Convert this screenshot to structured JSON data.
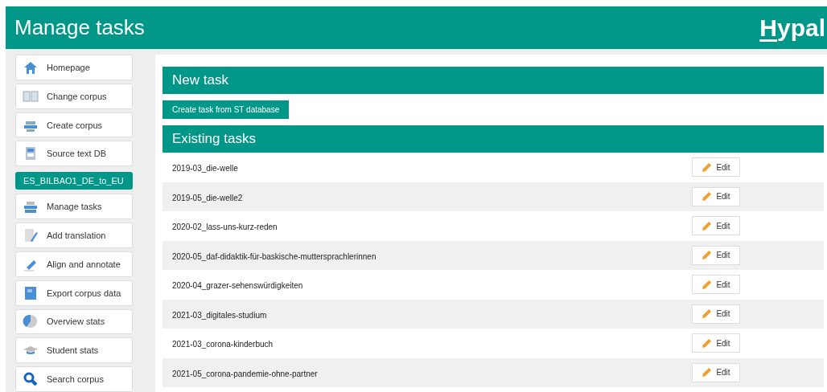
{
  "header": {
    "title": "Manage tasks",
    "logo": "Hypal"
  },
  "sidebar": {
    "items": [
      {
        "kind": "nav",
        "label": "Homepage"
      },
      {
        "kind": "nav",
        "label": "Change corpus"
      },
      {
        "kind": "nav",
        "label": "Create corpus"
      },
      {
        "kind": "nav",
        "label": "Source text DB"
      },
      {
        "kind": "corpus",
        "label": "ES_BILBAO1_DE_to_EU"
      },
      {
        "kind": "nav",
        "label": "Manage tasks"
      },
      {
        "kind": "nav",
        "label": "Add translation"
      },
      {
        "kind": "nav",
        "label": "Align and annotate"
      },
      {
        "kind": "nav",
        "label": "Export corpus data"
      },
      {
        "kind": "nav",
        "label": "Overview stats"
      },
      {
        "kind": "nav",
        "label": "Student stats"
      },
      {
        "kind": "nav",
        "label": "Search corpus"
      }
    ]
  },
  "new_task": {
    "heading": "New task",
    "button": "Create task from ST database"
  },
  "existing_tasks": {
    "heading": "Existing tasks",
    "rows": [
      {
        "name": "2019-03_die-welle",
        "action": "Edit"
      },
      {
        "name": "2019-05_die-welle2",
        "action": "Edit"
      },
      {
        "name": "2020-02_lass-uns-kurz-reden",
        "action": "Edit"
      },
      {
        "name": "2020-05_daf-didaktik-für-baskische-muttersprachlerinnen",
        "action": "Edit"
      },
      {
        "name": "2020-04_grazer-sehenswürdigkeiten",
        "action": "Edit"
      },
      {
        "name": "2021-03_digitales-studium",
        "action": "Edit"
      },
      {
        "name": "2021-03_corona-kinderbuch",
        "action": "Edit"
      },
      {
        "name": "2021-05_corona-pandemie-ohne-partner",
        "action": "Edit"
      }
    ]
  }
}
